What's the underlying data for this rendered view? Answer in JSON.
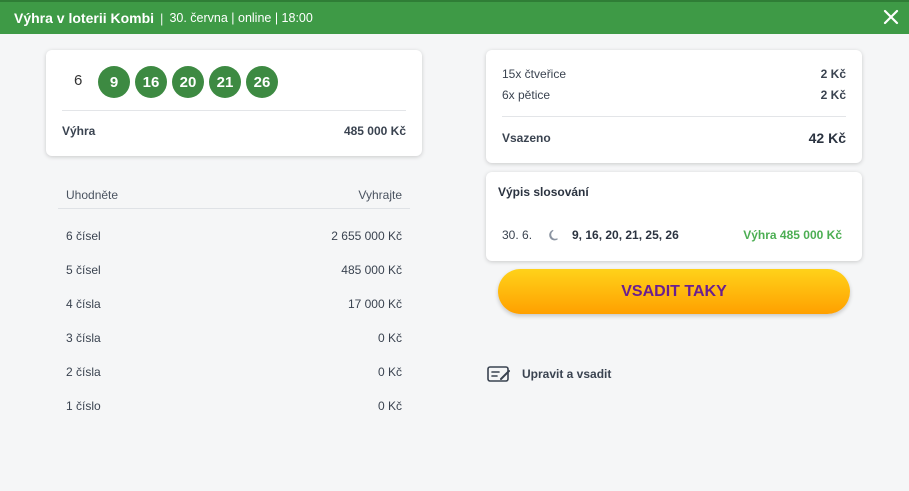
{
  "header": {
    "title": "Výhra v loterii Kombi",
    "separator": "|",
    "meta": "30. června | online | 18:00",
    "bg_color": "#3e9a46"
  },
  "ticket": {
    "first_number": "6",
    "balls": [
      "9",
      "16",
      "20",
      "21",
      "26"
    ],
    "win_label": "Výhra",
    "win_amount": "485 000 Kč"
  },
  "prize_table": {
    "col_guess": "Uhodněte",
    "col_win": "Vyhrajte",
    "rows": [
      {
        "guess": "6 čísel",
        "win": "2 655 000 Kč"
      },
      {
        "guess": "5 čísel",
        "win": "485 000 Kč"
      },
      {
        "guess": "4 čísla",
        "win": "17 000 Kč"
      },
      {
        "guess": "3 čísla",
        "win": "0 Kč"
      },
      {
        "guess": "2 čísla",
        "win": "0 Kč"
      },
      {
        "guess": "1 číslo",
        "win": "0 Kč"
      }
    ]
  },
  "summary": {
    "line1_label": "15x čtveřice",
    "line1_amount": "2 Kč",
    "line2_label": "6x pětice",
    "line2_amount": "2 Kč",
    "total_label": "Vsazeno",
    "total_amount": "42 Kč"
  },
  "draws": {
    "title": "Výpis slosování",
    "date": "30. 6.",
    "numbers": "9, 16, 20, 21, 25, 26",
    "win": "Výhra 485 000 Kč",
    "win_color": "#4cae53"
  },
  "bet_button": {
    "label": "VSADIT TAKY",
    "text_color": "#6b1f8f"
  },
  "edit": {
    "label": "Upravit a vsadit"
  }
}
